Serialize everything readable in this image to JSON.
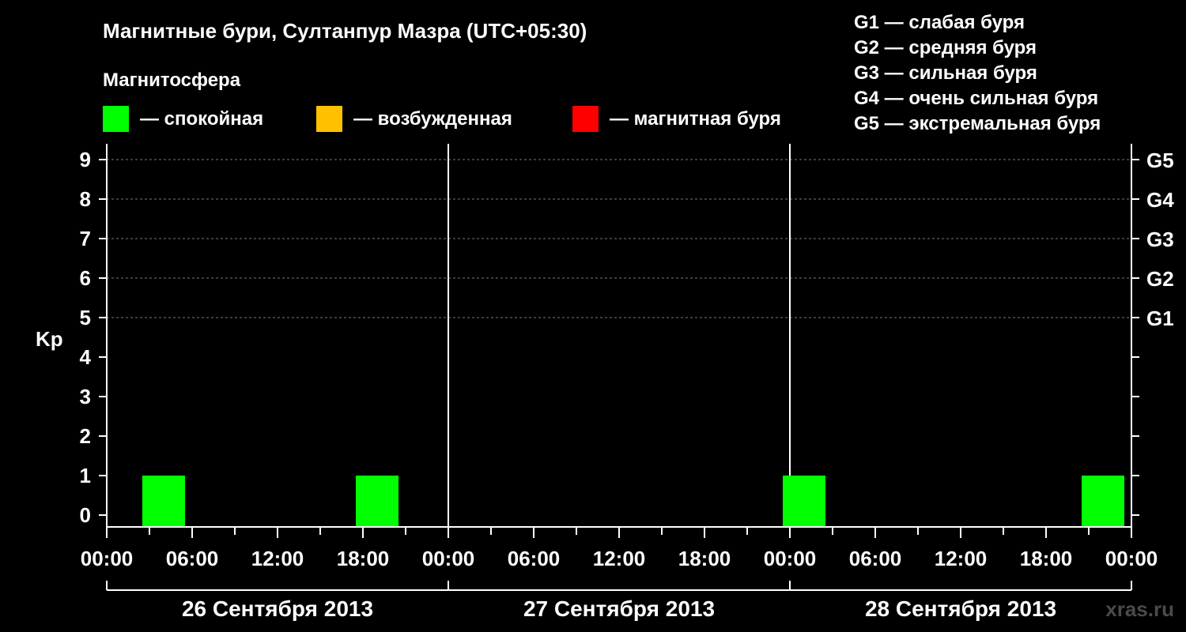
{
  "chart_data": {
    "type": "bar",
    "title": "Магнитные бури, Султанпур Мазра (UTC+05:30)",
    "legend_title": "Магнитосфера",
    "legend": [
      {
        "label": "— спокойная",
        "color": "#00ff00"
      },
      {
        "label": "— возбужденная",
        "color": "#ffc000"
      },
      {
        "label": "— магнитная буря",
        "color": "#ff0000"
      }
    ],
    "storm_scale": [
      "G1 — слабая буря",
      "G2 — средняя буря",
      "G3 — сильная буря",
      "G4 — очень сильная буря",
      "G5 — экстремальная буря"
    ],
    "ylabel": "Kp",
    "ylim": [
      0,
      9
    ],
    "y_ticks": [
      "0",
      "1",
      "2",
      "3",
      "4",
      "5",
      "6",
      "7",
      "8",
      "9"
    ],
    "right_ticks": [
      {
        "kp": 5,
        "label": "G1"
      },
      {
        "kp": 6,
        "label": "G2"
      },
      {
        "kp": 7,
        "label": "G3"
      },
      {
        "kp": 8,
        "label": "G4"
      },
      {
        "kp": 9,
        "label": "G5"
      }
    ],
    "grid": true,
    "x_range_hours": [
      0,
      72
    ],
    "x_tick_labels": [
      "00:00",
      "06:00",
      "12:00",
      "18:00",
      "00:00",
      "06:00",
      "12:00",
      "18:00",
      "00:00",
      "06:00",
      "12:00",
      "18:00",
      "00:00"
    ],
    "days": [
      "26 Сентября 2013",
      "27 Сентября 2013",
      "28 Сентября 2013"
    ],
    "bars": [
      {
        "start": "26 Сентября 2013 02:30",
        "end": "26 Сентября 2013 05:30",
        "kp": 1,
        "color": "#00ff00"
      },
      {
        "start": "26 Сентября 2013 17:30",
        "end": "26 Сентября 2013 20:30",
        "kp": 1,
        "color": "#00ff00"
      },
      {
        "start": "27 Сентября 2013 23:30",
        "end": "28 Сентября 2013 02:30",
        "kp": 1,
        "color": "#00ff00"
      },
      {
        "start": "28 Сентября 2013 20:30",
        "end": "28 Сентября 2013 23:30",
        "kp": 1,
        "color": "#00ff00"
      }
    ]
  },
  "watermark": "xras.ru"
}
